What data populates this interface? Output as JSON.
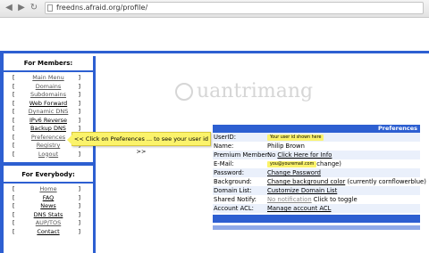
{
  "browser": {
    "url": "freedns.afraid.org/profile/"
  },
  "sidebar": {
    "members_title": "For Members:",
    "members": [
      {
        "label": "Main Menu",
        "style": "link"
      },
      {
        "label": "Domains",
        "style": "link"
      },
      {
        "label": "Subdomains",
        "style": "link"
      },
      {
        "label": "Web Forward",
        "style": "cur"
      },
      {
        "label": "Dynamic DNS",
        "style": "link"
      },
      {
        "label": "IPv6 Reverse",
        "style": "cur"
      },
      {
        "label": "Backup DNS",
        "style": "cur"
      },
      {
        "label": "Preferences",
        "style": "link"
      },
      {
        "label": "Registry",
        "style": "link"
      },
      {
        "label": "Logout",
        "style": "link"
      }
    ],
    "everybody_title": "For Everybody:",
    "everybody": [
      {
        "label": "Home",
        "style": "link"
      },
      {
        "label": "FAQ",
        "style": "cur"
      },
      {
        "label": "News",
        "style": "cur"
      },
      {
        "label": "DNS Stats",
        "style": "cur"
      },
      {
        "label": "AUP/TOS",
        "style": "link"
      },
      {
        "label": "Contact",
        "style": "cur"
      }
    ],
    "bracket_left": "[",
    "bracket_right": "]"
  },
  "watermark": "uantrimang",
  "callout": "<< Click on Preferences ... to see your user id >>",
  "preferences": {
    "title": "Preferences",
    "rows": [
      {
        "label": "UserID:",
        "highlight": "Your user id shown here"
      },
      {
        "label": "Name:",
        "value": "Philip Brown"
      },
      {
        "label": "Premium Member:",
        "prefix": "No ",
        "link": "Click Here for Info"
      },
      {
        "label": "E-Mail:",
        "highlight": "you@youremail.com",
        "suffix": "change)"
      },
      {
        "label": "Password:",
        "link": "Change Password"
      },
      {
        "label": "Background:",
        "link": "Change background color",
        "suffix": " (currently cornflowerblue)"
      },
      {
        "label": "Domain List:",
        "link": "Customize Domain List"
      },
      {
        "label": "Shared Notify:",
        "graylink": "No notification",
        "suffix": " Click to toggle"
      },
      {
        "label": "Account ACL:",
        "link": "Manage account ACL"
      }
    ]
  },
  "colors": {
    "accent": "#2d5fd1",
    "highlight": "#fbf36b"
  }
}
